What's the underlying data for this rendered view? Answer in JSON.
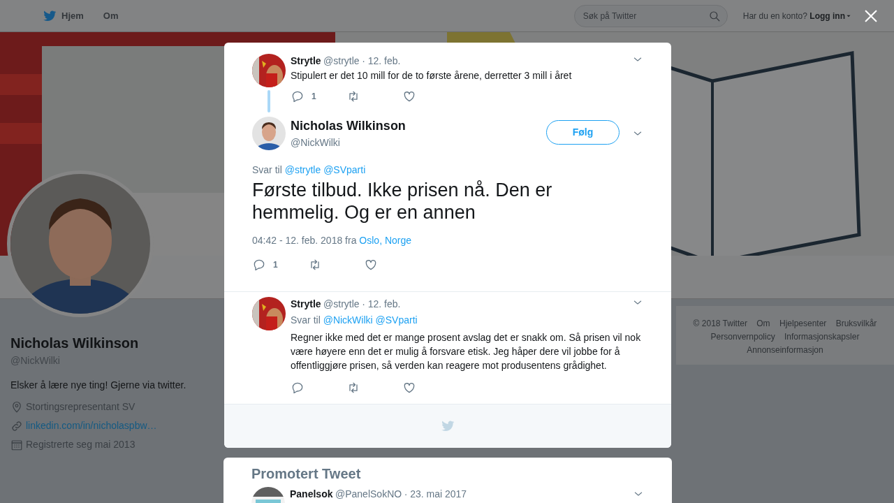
{
  "nav": {
    "items": [
      {
        "label": "Hjem",
        "kind": "home"
      },
      {
        "label": "Om",
        "kind": "plain"
      }
    ],
    "search": {
      "placeholder": "Søk på Twitter"
    },
    "account_prompt": "Har du en konto?",
    "login": "Logg inn"
  },
  "profile": {
    "name": "Nicholas Wilkinson",
    "handle": "@NickWilki",
    "bio": "Elsker å lære nye ting! Gjerne via twitter.",
    "details": [
      {
        "kind": "location",
        "text": "Stortingsrepresentant SV"
      },
      {
        "kind": "link",
        "text": "linkedin.com/in/nicholaspbw…"
      },
      {
        "kind": "joined",
        "text": "Registrerte seg mai 2013"
      }
    ]
  },
  "footer_links": [
    "© 2018 Twitter",
    "Om",
    "Hjelpesenter",
    "Bruksvilkår",
    "Personvernpolicy",
    "Informasjonskapsler",
    "Annonseinformasjon"
  ],
  "modal": {
    "tweets": [
      {
        "kind": "parent",
        "author": "Strytle",
        "handle": "@strytle",
        "date": "· 12. feb.",
        "text": "Stipulert er det 10 mill for de to første årene, derretter 3 mill i året",
        "replies": "1"
      },
      {
        "kind": "main",
        "author": "Nicholas Wilkinson",
        "handle": "@NickWilki",
        "follow": "Følg",
        "reply_prefix": "Svar til",
        "mentions": [
          "@strytle",
          "@SVparti"
        ],
        "text": "Første tilbud. Ikke prisen nå. Den er hemmelig. Og er en annen",
        "timestamp": "04:42 - 12. feb. 2018 fra",
        "place": "Oslo, Norge",
        "replies": "1"
      },
      {
        "kind": "reply",
        "author": "Strytle",
        "handle": "@strytle",
        "date": "· 12. feb.",
        "reply_prefix": "Svar til",
        "mentions": [
          "@NickWilki",
          "@SVparti"
        ],
        "text": "Regner ikke med det er mange prosent avslag det er snakk om. Så prisen vil nok være høyere enn det er mulig å forsvare etisk. Jeg håper dere vil jobbe for å offentliggjøre prisen, så verden kan reagere mot produsentens grådighet."
      }
    ]
  },
  "promoted": {
    "label": "Promotert Tweet",
    "author": "Panelsok",
    "handle": "@PanelSokNO",
    "date": "· 23. mai 2017"
  }
}
